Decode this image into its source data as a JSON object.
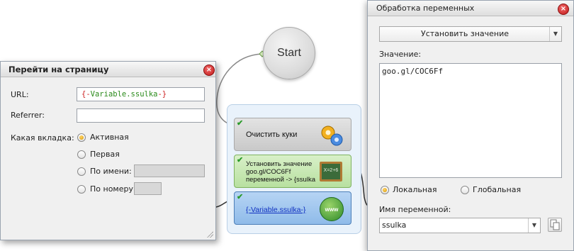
{
  "canvas": {
    "start_label": "Start",
    "blocks": {
      "clear_cookies": {
        "label": "Очистить куки",
        "icon": "gears-icon"
      },
      "set_value": {
        "label": "Установить значение goo.gl/COC6Ff переменной -> {ssulka",
        "icon": "chalkboard-icon"
      },
      "goto_page": {
        "label": "{-Variable.ssulka-}",
        "icon": "www-globe-icon"
      }
    }
  },
  "goto_dialog": {
    "title": "Перейти на страницу",
    "url_label": "URL:",
    "url_value_open": "{-",
    "url_value_var": "Variable.ssulka",
    "url_value_close": "-}",
    "referrer_label": "Referrer:",
    "referrer_value": "",
    "tab_label": "Какая вкладка:",
    "tab_options": [
      "Активная",
      "Первая",
      "По имени:",
      "По номеру:"
    ],
    "tab_selected": "Активная"
  },
  "variables_dialog": {
    "title": "Обработка переменных",
    "action_selected": "Установить значение",
    "value_label": "Значение:",
    "value_text": "goo.gl/COC6Ff",
    "scope_options": [
      "Локальная",
      "Глобальная"
    ],
    "scope_selected": "Локальная",
    "var_name_label": "Имя переменной:",
    "var_name_value": "ssulka"
  },
  "colors": {
    "set_value_block": "#b8e0a0",
    "goto_block": "#8fbbe9",
    "cookies_block": "#c9c9c9",
    "close_button": "#c01818"
  }
}
